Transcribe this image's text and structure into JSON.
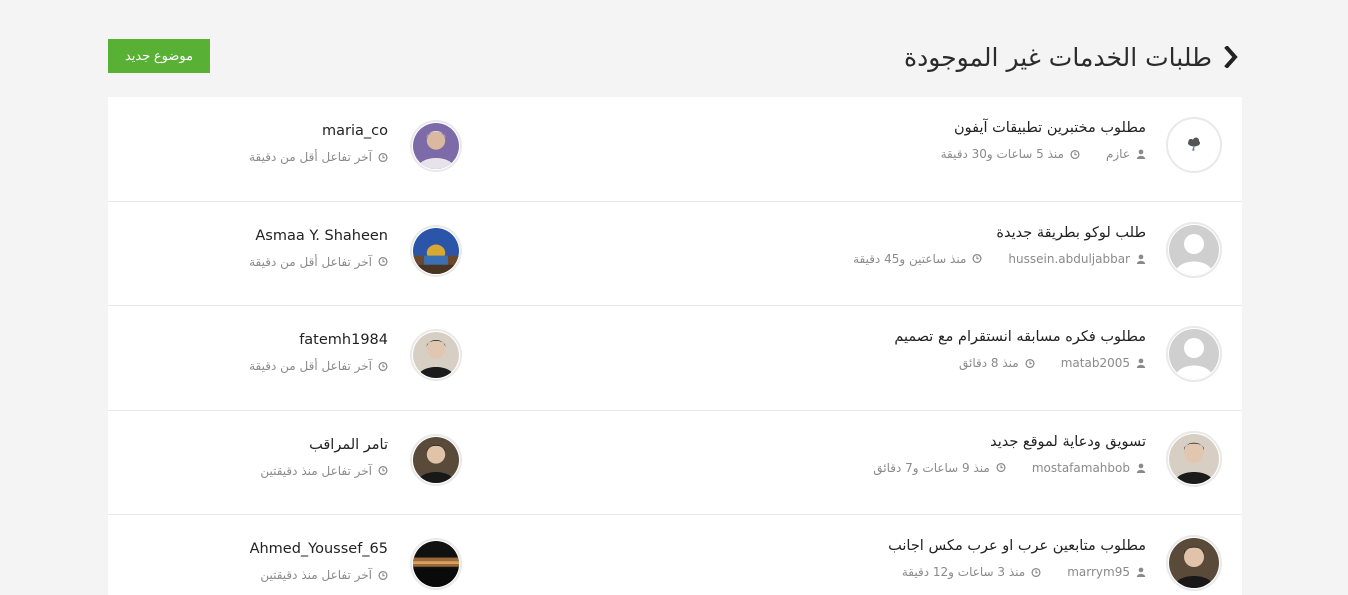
{
  "header": {
    "title": "طلبات الخدمات غير الموجودة",
    "new_topic_label": "موضوع جديد"
  },
  "colors": {
    "accent": "#58b035",
    "title": "#2b2b2b",
    "meta": "#8a8a8a"
  },
  "topics": [
    {
      "title": "مطلوب مختبرين تطبيقات آيفون",
      "author": "عازم",
      "time": "منذ 5 ساعات و30 دقيقة",
      "avatar": "weather-cloud-icon",
      "last_user": "maria_co",
      "last_activity": "آخر تفاعل أقل من دقيقة",
      "last_avatar": "user-photo"
    },
    {
      "title": "طلب لوكو بطريقة جديدة",
      "author": "hussein.abduljabbar",
      "time": "منذ ساعتين و45 دقيقة",
      "avatar": "default-user-icon",
      "last_user": "Asmaa Y. Shaheen",
      "last_activity": "آخر تفاعل أقل من دقيقة",
      "last_avatar": "dome-photo"
    },
    {
      "title": "مطلوب فكره مسابقه انستقرام مع تصميم",
      "author": "matab2005",
      "time": "منذ 8 دقائق",
      "avatar": "default-user-icon",
      "last_user": "fatemh1984",
      "last_activity": "آخر تفاعل أقل من دقيقة",
      "last_avatar": "user-photo"
    },
    {
      "title": "تسويق ودعاية لموقع جديد",
      "author": "mostafamahbob",
      "time": "منذ 9 ساعات و7 دقائق",
      "avatar": "user-photo",
      "last_user": "تامر المراقب",
      "last_activity": "آخر تفاعل منذ دقيقتين",
      "last_avatar": "user-photo"
    },
    {
      "title": "مطلوب متابعين عرب او عرب مكس اجانب",
      "author": "marrym95",
      "time": "منذ 3 ساعات و12 دقيقة",
      "avatar": "user-photo",
      "last_user": "Ahmed_Youssef_65",
      "last_activity": "آخر تفاعل منذ دقيقتين",
      "last_avatar": "sunset-photo"
    }
  ]
}
